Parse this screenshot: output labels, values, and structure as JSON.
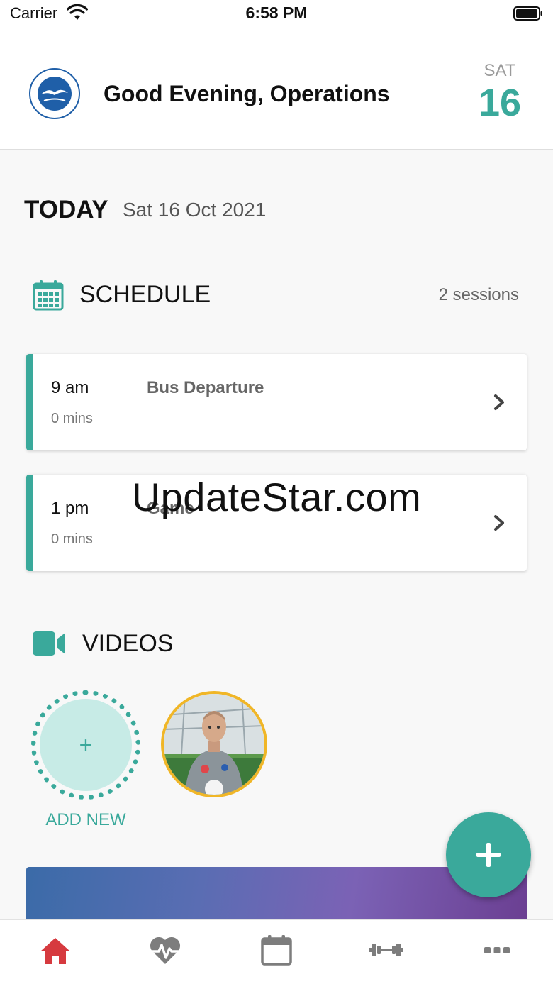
{
  "status_bar": {
    "carrier": "Carrier",
    "time": "6:58 PM"
  },
  "header": {
    "greeting": "Good Evening, Operations",
    "day": "SAT",
    "date_number": "16",
    "logo_icon": "club-crest-icon"
  },
  "today": {
    "label": "TODAY",
    "date": "Sat 16 Oct 2021"
  },
  "schedule": {
    "title": "SCHEDULE",
    "count": "2 sessions",
    "sessions": [
      {
        "time": "9 am",
        "duration": "0 mins",
        "title": "Bus Departure"
      },
      {
        "time": "1 pm",
        "duration": "0 mins",
        "title": "Game"
      }
    ]
  },
  "watermark": "UpdateStar.com",
  "videos": {
    "title": "VIDEOS",
    "add_new_symbol": "+",
    "add_new_label": "ADD NEW"
  },
  "colors": {
    "accent": "#3aa99b",
    "home_active": "#d63a3f",
    "tab_inactive": "#7d7d7d",
    "thumb_border": "#f0b627"
  },
  "tabs": [
    "home-icon",
    "heartbeat-icon",
    "calendar-icon",
    "dumbbell-icon",
    "more-icon"
  ]
}
